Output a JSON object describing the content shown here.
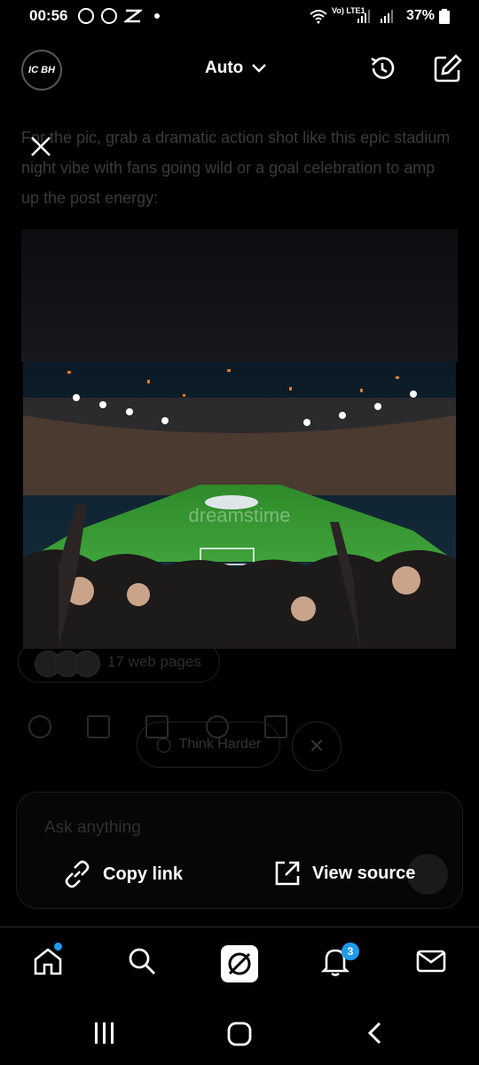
{
  "status": {
    "time": "00:56",
    "network": "Vo) LTE1",
    "battery": "37%"
  },
  "header": {
    "avatar_text": "IC BH",
    "model_label": "Auto"
  },
  "chat": {
    "response_text": "For the pic, grab a dramatic action shot like this epic stadium night vibe with fans going wild or a goal celebration to amp up the post energy:",
    "image_watermark": "dreamstime",
    "sources_label": "17 web pages",
    "think_harder_label": "Think Harder",
    "input_placeholder": "Ask anything"
  },
  "overlay": {
    "copy_link_label": "Copy link",
    "view_source_label": "View source"
  },
  "nav": {
    "notifications_badge": "3"
  },
  "colors": {
    "accent": "#1d9bf0",
    "background": "#000000"
  }
}
